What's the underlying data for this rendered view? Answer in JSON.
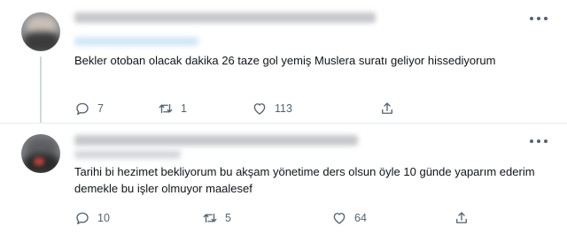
{
  "tweets": [
    {
      "text": "Bekler otoban olacak dakika 26 taze gol yemiş Muslera suratı geliyor hissediyorum",
      "replies": "7",
      "retweets": "1",
      "likes": "113"
    },
    {
      "text": "Tarihi bi hezimet bekliyorum bu akşam yönetime ders olsun öyle 10 günde yaparım ederim demekle bu işler olmuyor maalesef",
      "replies": "10",
      "retweets": "5",
      "likes": "64"
    }
  ],
  "icons": {
    "more": "more-horizontal-icon",
    "reply": "reply-icon",
    "retweet": "retweet-icon",
    "like": "heart-icon",
    "share": "share-icon"
  },
  "colors": {
    "text": "#0f1419",
    "secondary": "#536471",
    "divider": "#e6ecf0",
    "thread_line": "#cfd9de"
  }
}
